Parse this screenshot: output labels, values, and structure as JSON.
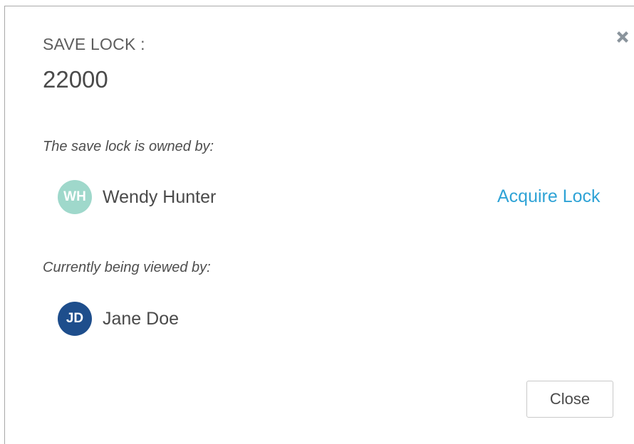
{
  "dialog": {
    "header_label": "SAVE LOCK :",
    "header_value": "22000",
    "close_icon": "close-x-icon",
    "owned_label": "The save lock is owned by:",
    "owner": {
      "initials": "WH",
      "name": "Wendy Hunter",
      "avatar_color": "#9fd8cb"
    },
    "acquire_label": "Acquire Lock",
    "viewed_label": "Currently being viewed by:",
    "viewers": [
      {
        "initials": "JD",
        "name": "Jane Doe",
        "avatar_color": "#1e4e8c"
      }
    ],
    "close_button_label": "Close"
  },
  "colors": {
    "link": "#2fa3d6",
    "text": "#4a4a4a",
    "close_icon": "#8a949c"
  }
}
